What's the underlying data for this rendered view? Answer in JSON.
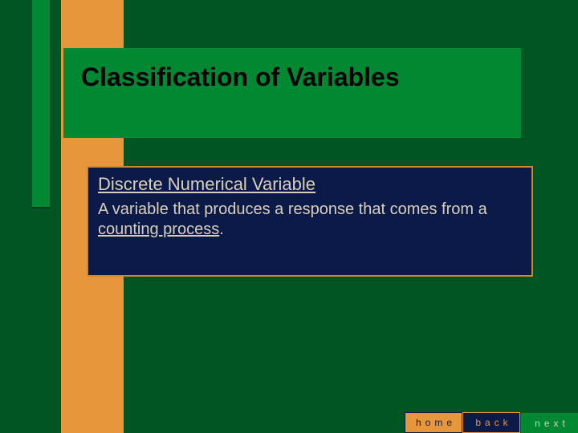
{
  "title": "Classification of Variables",
  "content": {
    "subtitle": "Discrete Numerical Variable",
    "body_pre": "A variable that produces a response that comes from a ",
    "body_underlined": "counting process",
    "body_post": "."
  },
  "nav": {
    "home": "home",
    "back": "back",
    "next": "next"
  }
}
